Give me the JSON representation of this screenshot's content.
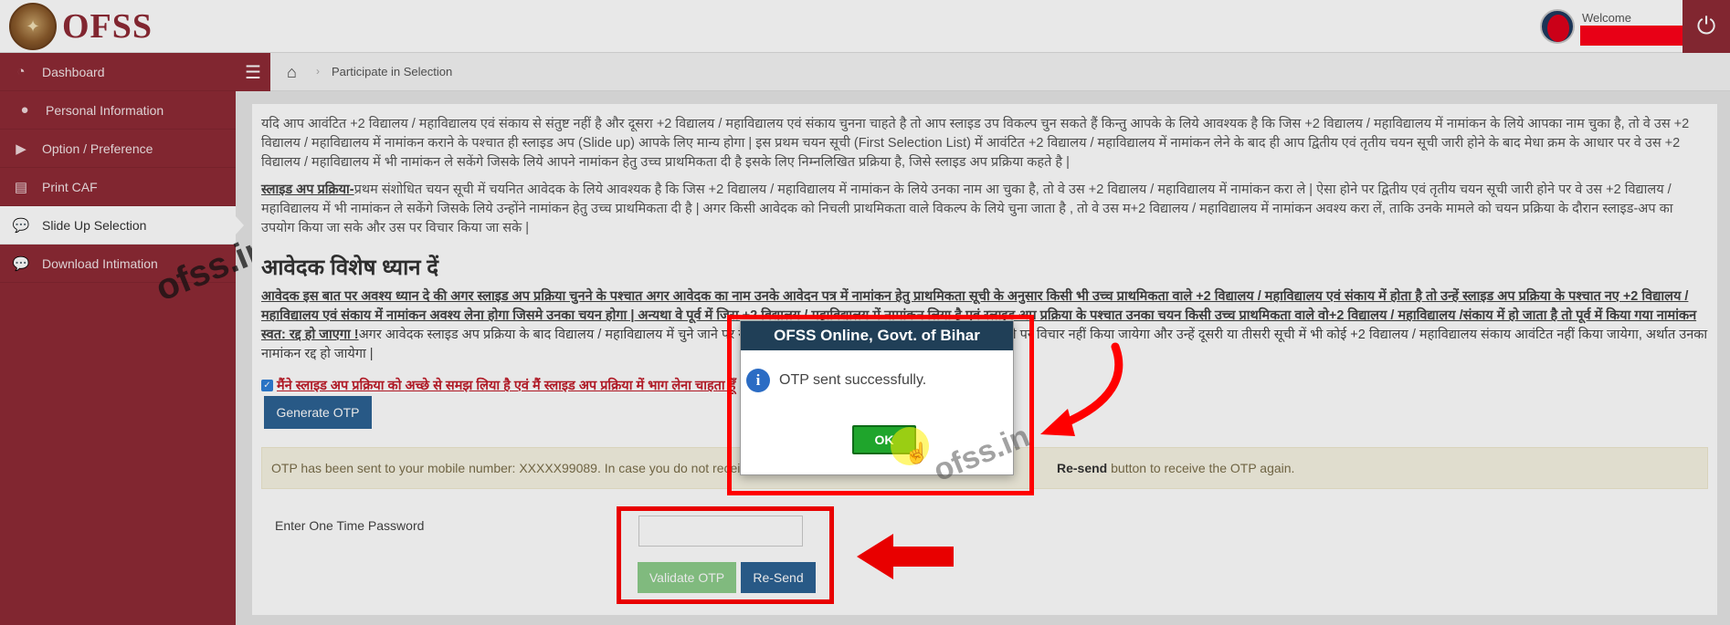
{
  "header": {
    "logo_text": "OFSS",
    "welcome_label": "Welcome"
  },
  "sidebar": {
    "items": [
      {
        "label": "Dashboard",
        "icon": "dashboard-icon"
      },
      {
        "label": "Personal Information",
        "icon": "user-icon"
      },
      {
        "label": "Option / Preference",
        "icon": "play-icon"
      },
      {
        "label": "Print CAF",
        "icon": "id-card-icon"
      },
      {
        "label": "Slide Up Selection",
        "icon": "comments-icon"
      },
      {
        "label": "Download Intimation",
        "icon": "comments-icon"
      }
    ]
  },
  "breadcrumb": {
    "current": "Participate in Selection"
  },
  "main": {
    "para1": "यदि आप आवंटित +2 विद्यालय / महाविद्यालय एवं संकाय से संतुष्ट नहीं है और दूसरा +2 विद्यालय / महाविद्यालय एवं संकाय चुनना चाहते है तो आप स्लाइड उप विकल्प चुन सकते हैं किन्तु आपके के लिये आवश्यक है कि जिस +2 विद्यालय / महाविद्यालय में नामांकन के लिये आपका नाम चुका है, तो वे उस +2 विद्यालय / महाविद्यालय में नामांकन कराने के पश्चात ही स्लाइड अप (Slide up) आपके लिए मान्य होगा | इस प्रथम चयन सूची (First Selection List) में आवंटित +2 विद्यालय / महाविद्यालय में नामांकन लेने के बाद ही आप द्वितीय एवं तृतीय चयन सूची जारी होने के बाद मेधा क्रम के आधार पर वे उस +2 विद्यालय / महाविद्यालय में भी नामांकन ले सकेंगे जिसके लिये आपने नामांकन हेतु उच्च प्राथमिकता दी है इसके लिए निम्नलिखित प्रक्रिया है, जिसे स्लाइड अप प्रक्रिया कहते है |",
    "para2_head": "स्लाइड अप प्रक्रिया-",
    "para2_body": "प्रथम संशोधित चयन सूची में चयनित आवेदक के लिये आवश्यक है कि जिस +2 विद्यालय / महाविद्यालय में नामांकन के लिये उनका नाम आ चुका है, तो वे उस +2 विद्यालय / महाविद्यालय में नामांकन करा ले | ऐसा होने पर द्वितीय एवं तृतीय चयन सूची जारी होने पर वे उस +2 विद्यालय / महाविद्यालय में भी नामांकन ले सकेंगे जिसके लिये उन्होंने नामांकन हेतु उच्च प्राथमिकता दी है | अगर किसी आवेदक को निचली प्राथमिकता वाले विकल्प के लिये चुना जाता है , तो वे उस म+2 विद्यालय / महाविद्यालय में नामांकन अवश्य करा लें, ताकि उनके मामले को चयन प्रक्रिया के दौरान स्लाइड-अप का उपयोग किया जा सके और उस पर विचार किया जा सके |",
    "heading": "आवेदक विशेष ध्यान दें",
    "para3_emph": "आवेदक इस बात पर अवश्य ध्यान दे की अगर स्लाइड अप प्रक्रिया चुनने के पश्चात अगर आवेदक का नाम उनके आवेदन पत्र में नामांकन हेतु प्राथमिकता सूची के अनुसार किसी भी उच्च प्राथमिकता वाले +2 विद्यालय / महाविद्यालय एवं संकाय में होता है तो उन्हें स्लाइड अप प्रक्रिया के पश्चात नए +2 विद्यालय / महाविद्यालय एवं संकाय में नामांकन अवश्य लेना होगा जिसमे उनका चयन होगा | अन्यथा वे पूर्व में जिस +2 विद्यालय / महाविद्यालय में नामांकन लिया है एवं स्लाइड अप प्रक्रिया के पश्चात उनका चयन किसी उच्च प्राथमिकता वाले वो+2 विद्यालय / महाविद्यालय /संकाय में हो जाता है तो पूर्व में किया गया नामांकन स्वत: रद्द हो जाएगा !",
    "para3_rest": "अगर आवेदक स्लाइड अप प्रक्रिया के बाद विद्यालय / महाविद्यालय में चुने जाने पर नामांकन नहीं लेते है तो स्लाइडिंग अप के जरिये उनके मामले पर विचार नहीं किया जायेगा और उन्हें दूसरी या तीसरी सूची में भी कोई +2 विद्यालय / महाविद्यालय संकाय आवंटित नहीं किया जायेगा, अर्थात उनका नामांकन रद्द हो जायेगा |",
    "agree_text": "मैंने स्लाइड अप प्रक्रिया को अच्छे से समझ लिया है एवं मैं स्लाइड अप प्रक्रिया में भाग लेना चाहता हूँ",
    "generate_otp": "Generate OTP",
    "otp_notice_start": "OTP has been sent to your mobile number: XXXXX99089. In case you do not receive",
    "otp_notice_resend": "Re-send",
    "otp_notice_end": "button to receive the OTP again.",
    "otp_label": "Enter One Time Password",
    "validate_otp": "Validate OTP",
    "resend": "Re-Send"
  },
  "dialog": {
    "title": "OFSS Online, Govt. of Bihar",
    "message": "OTP sent successfully.",
    "ok": "OK"
  },
  "watermark": "ofss.in",
  "colors": {
    "sidebar": "#8e2a35",
    "dialog_title": "#203f57",
    "ok_button": "#1fa52c",
    "primary_button": "#2d6294",
    "highlight_red": "#ff0000"
  }
}
